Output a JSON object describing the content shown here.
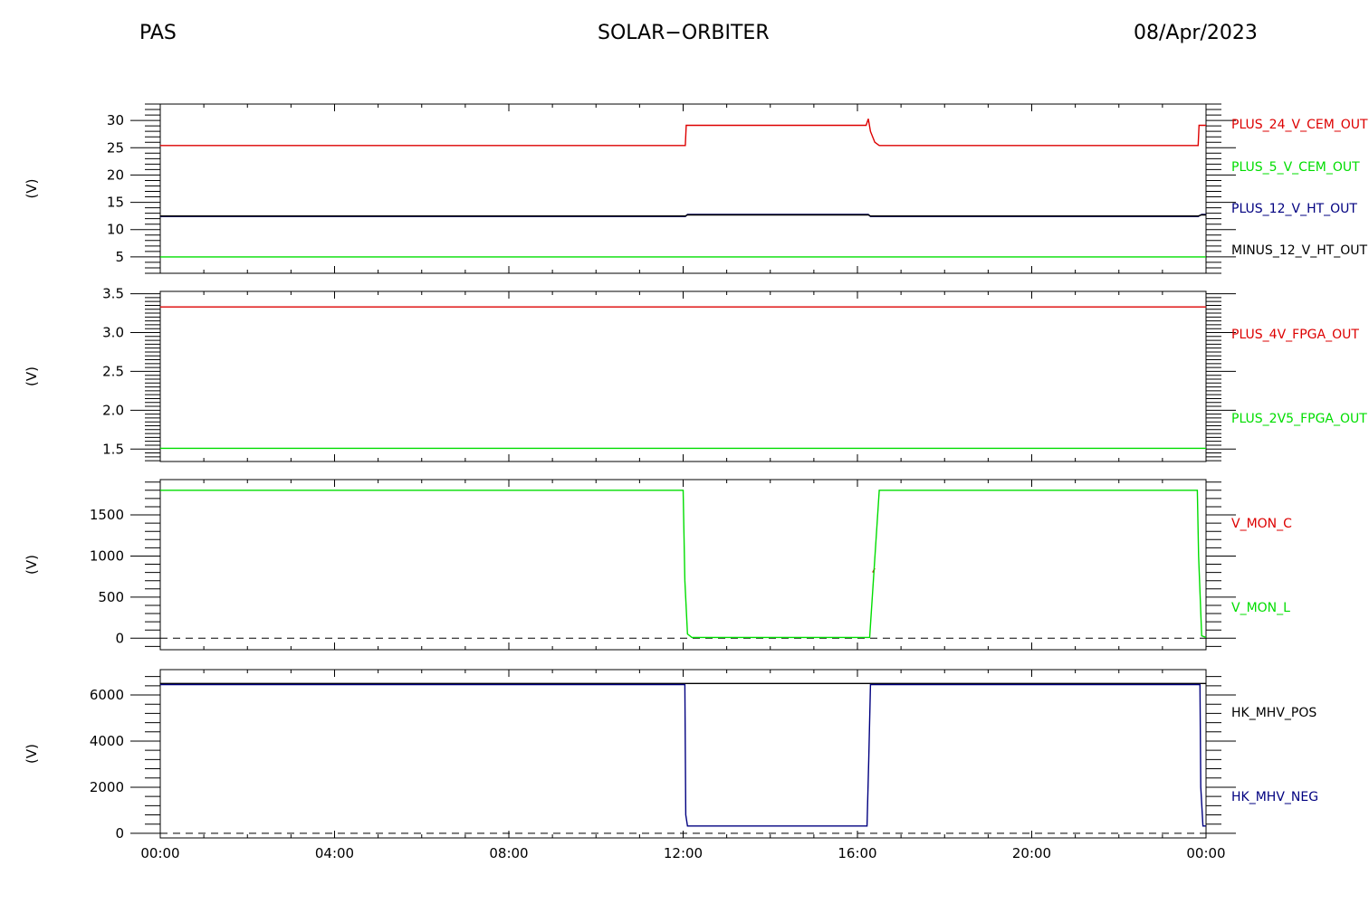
{
  "header": {
    "left": "PAS",
    "center": "SOLAR−ORBITER",
    "right": "08/Apr/2023"
  },
  "chart_data": [
    {
      "type": "line",
      "ylabel": "(V)",
      "ylim": [
        2,
        33
      ],
      "yticks": [
        5,
        10,
        15,
        20,
        25,
        30
      ],
      "ytick_labels": [
        "5",
        "10",
        "15",
        "20",
        "25",
        "30"
      ],
      "series": [
        {
          "name": "PLUS_24_V_CEM_OUT",
          "color": "#dd0000",
          "x": [
            0,
            12.05,
            12.07,
            16.2,
            16.25,
            16.3,
            16.4,
            16.5,
            23.82,
            23.84,
            24
          ],
          "y": [
            25.4,
            25.4,
            29.1,
            29.1,
            30.3,
            28.0,
            26.0,
            25.4,
            25.4,
            29.1,
            29.1
          ]
        },
        {
          "name": "PLUS_5_V_CEM_OUT",
          "color": "#00dd00",
          "x": [
            0,
            24
          ],
          "y": [
            5.0,
            5.0
          ]
        },
        {
          "name": "PLUS_12_V_HT_OUT",
          "color": "#000080",
          "x": [
            0,
            12.05,
            12.1,
            16.25,
            16.3,
            23.82,
            23.9,
            24
          ],
          "y": [
            12.4,
            12.4,
            12.8,
            12.8,
            12.4,
            12.4,
            12.8,
            12.8
          ]
        },
        {
          "name": "MINUS_12_V_HT_OUT",
          "color": "#000000",
          "x": [
            0,
            12.05,
            12.1,
            16.25,
            16.3,
            23.82,
            23.9,
            24
          ],
          "y": [
            12.5,
            12.5,
            12.7,
            12.7,
            12.5,
            12.5,
            12.7,
            12.7
          ]
        }
      ]
    },
    {
      "type": "line",
      "ylabel": "(V)",
      "ylim": [
        1.34,
        3.53
      ],
      "yticks": [
        1.5,
        2.0,
        2.5,
        3.0,
        3.5
      ],
      "ytick_labels": [
        "1.5",
        "2.0",
        "2.5",
        "3.0",
        "3.5"
      ],
      "series": [
        {
          "name": "PLUS_4V_FPGA_OUT",
          "color": "#dd0000",
          "x": [
            0,
            24
          ],
          "y": [
            3.33,
            3.33
          ]
        },
        {
          "name": "PLUS_2V5_FPGA_OUT",
          "color": "#00dd00",
          "x": [
            0,
            24
          ],
          "y": [
            1.51,
            1.51
          ]
        }
      ]
    },
    {
      "type": "line",
      "ylabel": "(V)",
      "ylim": [
        -140,
        1930
      ],
      "yticks": [
        0,
        500,
        1000,
        1500
      ],
      "ytick_labels": [
        "0",
        "500",
        "1000",
        "1500"
      ],
      "reference_line": 0,
      "series": [
        {
          "name": "V_MON_C",
          "color": "#dd0000",
          "x": [
            16.35,
            16.4
          ],
          "y": [
            800,
            850
          ]
        },
        {
          "name": "V_MON_L",
          "color": "#00dd00",
          "x": [
            0,
            12.0,
            12.04,
            12.1,
            12.2,
            16.28,
            16.5,
            23.8,
            23.83,
            23.9,
            24
          ],
          "y": [
            1800,
            1800,
            700,
            50,
            10,
            10,
            1800,
            1800,
            1000,
            30,
            10
          ]
        }
      ]
    },
    {
      "type": "line",
      "ylabel": "(V)",
      "ylim": [
        -200,
        7100
      ],
      "yticks": [
        0,
        2000,
        4000,
        6000
      ],
      "ytick_labels": [
        "0",
        "2000",
        "4000",
        "6000"
      ],
      "reference_line": 0,
      "series": [
        {
          "name": "HK_MHV_POS",
          "color": "#000000",
          "x": [
            0,
            24
          ],
          "y": [
            6500,
            6500
          ]
        },
        {
          "name": "HK_MHV_NEG",
          "color": "#000080",
          "x": [
            0,
            12.04,
            12.06,
            12.1,
            16.22,
            16.26,
            16.3,
            23.86,
            23.88,
            23.93,
            24
          ],
          "y": [
            6450,
            6450,
            800,
            320,
            320,
            3200,
            6450,
            6450,
            2000,
            320,
            320
          ]
        }
      ]
    }
  ],
  "x_axis": {
    "xlim": [
      0,
      24
    ],
    "ticks": [
      0,
      4,
      8,
      12,
      16,
      20,
      24
    ],
    "tick_labels": [
      "00:00",
      "04:00",
      "08:00",
      "12:00",
      "16:00",
      "20:00",
      "00:00"
    ]
  }
}
